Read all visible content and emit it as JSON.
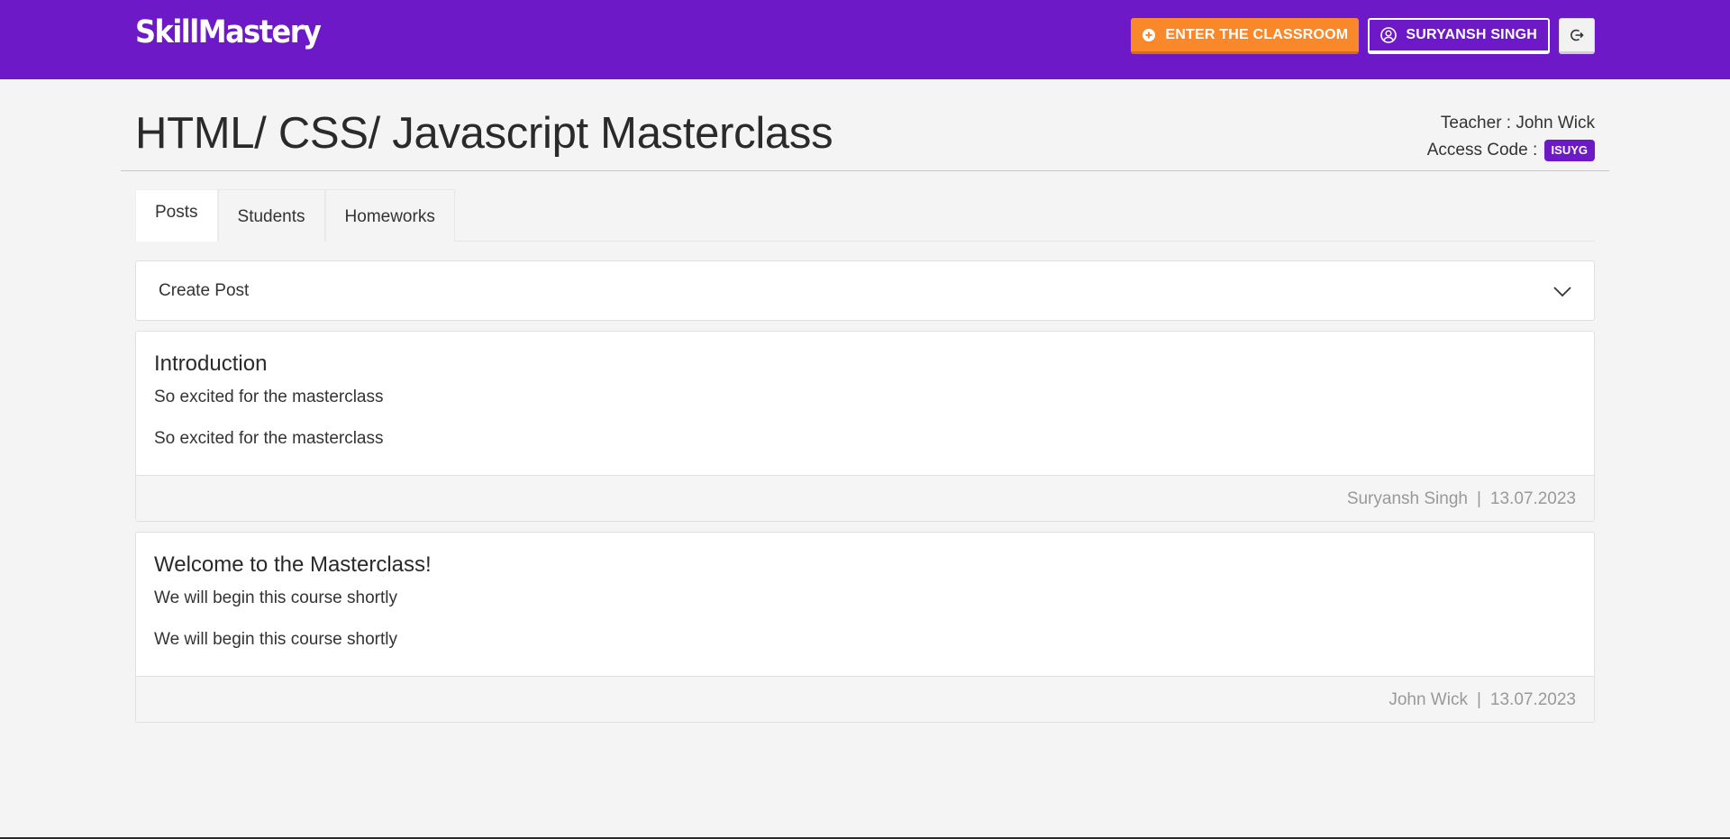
{
  "navbar": {
    "brand": "SkillMastery",
    "enter_classroom_label": "ENTER THE CLASSROOM",
    "user_label": "SURYANSH SINGH"
  },
  "course": {
    "title": "HTML/ CSS/ Javascript Masterclass",
    "teacher_text": "Teacher : John Wick",
    "access_code_label": "Access Code :",
    "access_code": "ISUYG"
  },
  "tabs": [
    {
      "label": "Posts",
      "active": true
    },
    {
      "label": "Students",
      "active": false
    },
    {
      "label": "Homeworks",
      "active": false
    }
  ],
  "create_post": {
    "label": "Create Post"
  },
  "posts": [
    {
      "title": "Introduction",
      "line1": "So excited for the masterclass",
      "line2": "So excited for the masterclass",
      "author": "Suryansh Singh",
      "separator": "|",
      "date": "13.07.2023"
    },
    {
      "title": "Welcome to the Masterclass!",
      "line1": "We will begin this course shortly",
      "line2": "We will begin this course shortly",
      "author": "John Wick",
      "separator": "|",
      "date": "13.07.2023"
    }
  ],
  "colors": {
    "primary": "#6d19c8",
    "accent": "#f8882a",
    "background": "#f4f4f4"
  },
  "icons": {
    "enter_classroom": "plus-circle-icon",
    "user": "user-circle-icon",
    "logout": "logout-icon",
    "create_post_toggle": "chevron-down-icon"
  }
}
